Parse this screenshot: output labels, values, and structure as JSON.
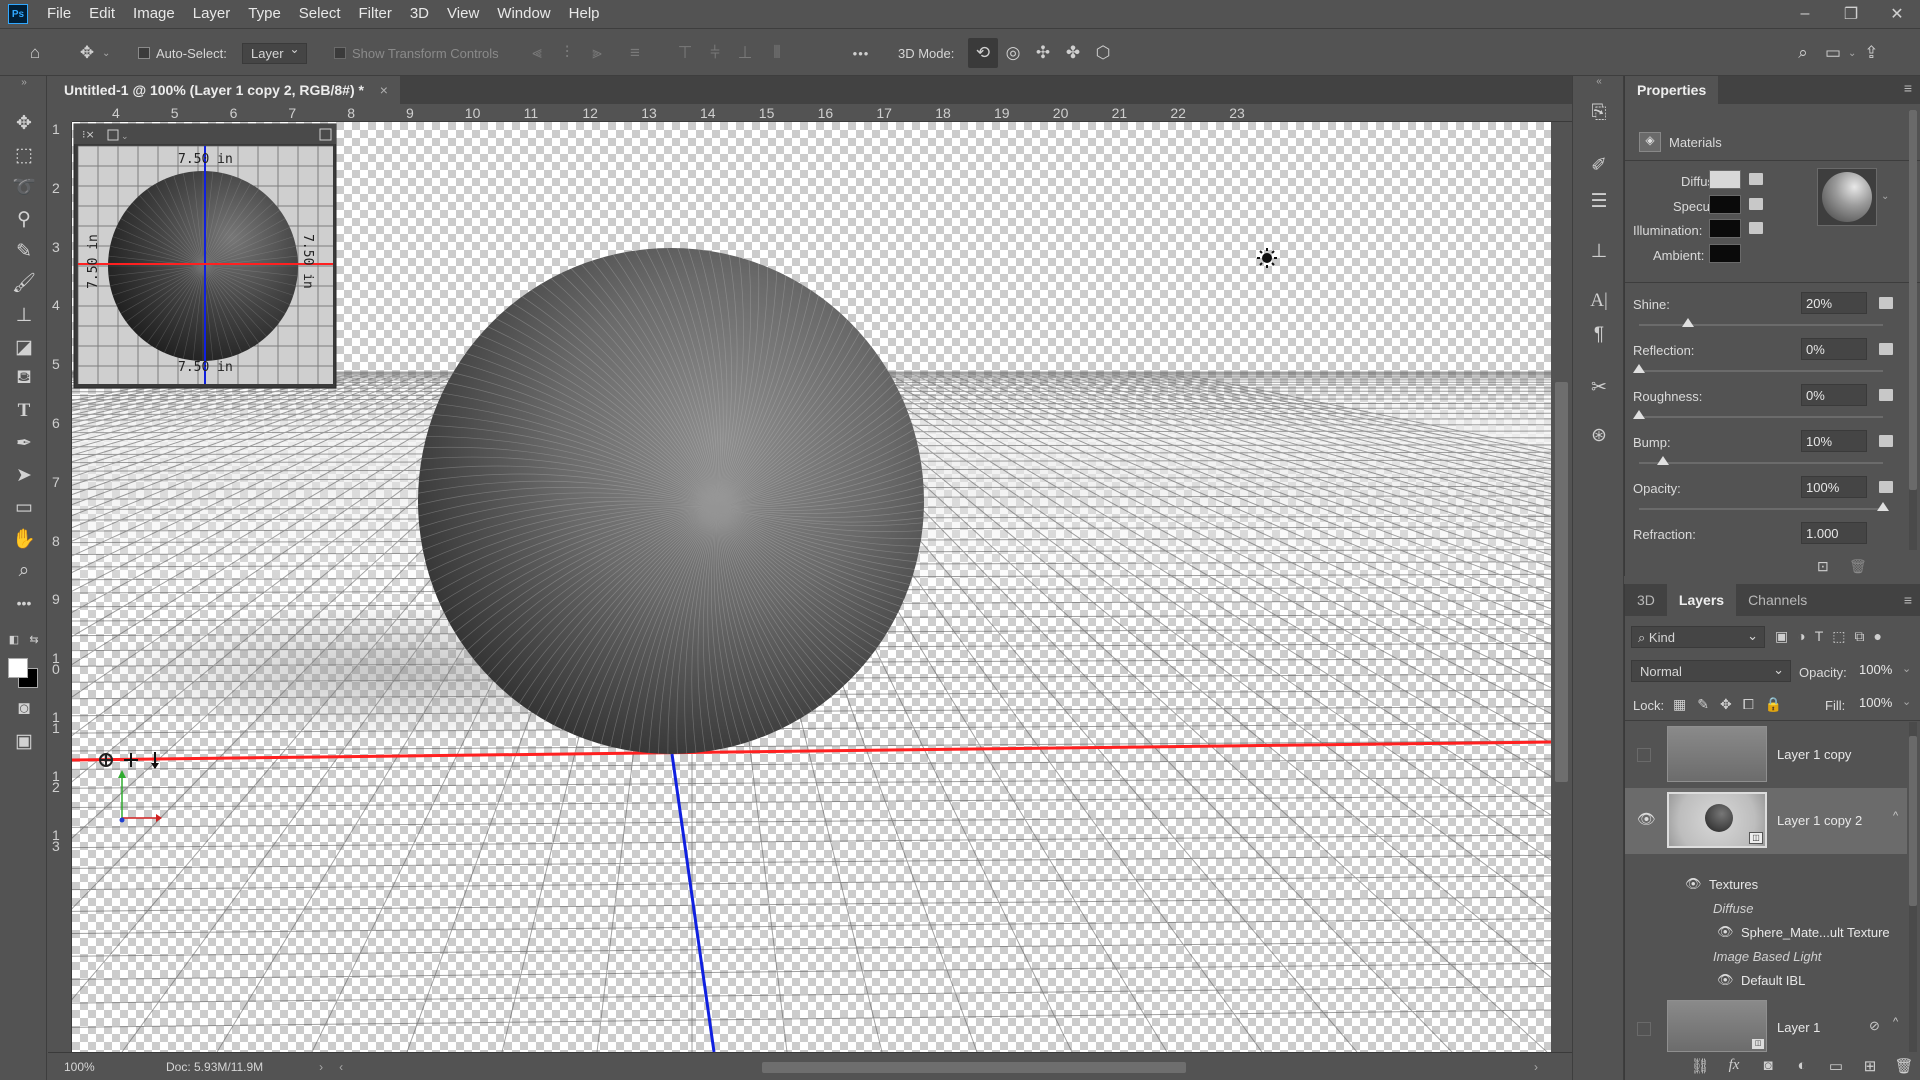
{
  "app": {
    "logo": "Ps"
  },
  "menu": [
    "File",
    "Edit",
    "Image",
    "Layer",
    "Type",
    "Select",
    "Filter",
    "3D",
    "View",
    "Window",
    "Help"
  ],
  "window_controls": {
    "minimize": "–",
    "restore": "❐",
    "close": "✕"
  },
  "options_bar": {
    "auto_select_label": "Auto-Select:",
    "auto_select_value": "Layer",
    "show_transform_label": "Show Transform Controls",
    "more_label": "•••",
    "mode_3d_label": "3D Mode:"
  },
  "document": {
    "tab_title": "Untitled-1 @ 100% (Layer 1 copy 2, RGB/8#) *",
    "tab_close": "×",
    "zoom": "100%",
    "doc_info": "Doc: 5.93M/11.9M",
    "ruler_top": [
      "4",
      "5",
      "6",
      "7",
      "8",
      "9",
      "10",
      "11",
      "12",
      "13",
      "14",
      "15",
      "16",
      "17",
      "18",
      "19",
      "20",
      "21",
      "22",
      "23"
    ],
    "ruler_left": [
      "1",
      "2",
      "3",
      "4",
      "5",
      "6",
      "7",
      "8",
      "9",
      "1\n0",
      "1\n1",
      "1\n2",
      "1\n3"
    ]
  },
  "secondary_view": {
    "label_top": "7.50 in",
    "label_bottom": "7.50 in",
    "label_left": "7.50 in",
    "label_right": "7.50 in"
  },
  "properties": {
    "tab": "Properties",
    "section": "Materials",
    "diffuse_label": "Diffuse:",
    "specular_label": "Specular:",
    "illumination_label": "Illumination:",
    "ambient_label": "Ambient:",
    "shine_label": "Shine:",
    "shine_value": "20%",
    "reflection_label": "Reflection:",
    "reflection_value": "0%",
    "roughness_label": "Roughness:",
    "roughness_value": "0%",
    "bump_label": "Bump:",
    "bump_value": "10%",
    "opacity_label": "Opacity:",
    "opacity_value": "100%",
    "refraction_label": "Refraction:",
    "refraction_value": "1.000",
    "colors": {
      "diffuse": "#d8d8d8",
      "specular": "#0a0a0a",
      "illumination": "#0a0a0a",
      "ambient": "#0a0a0a"
    }
  },
  "layers_panel": {
    "tabs": [
      "3D",
      "Layers",
      "Channels"
    ],
    "kind_label": "Kind",
    "blend_mode": "Normal",
    "opacity_label": "Opacity:",
    "opacity_value": "100%",
    "lock_label": "Lock:",
    "fill_label": "Fill:",
    "fill_value": "100%",
    "layers": [
      {
        "name": "Layer 1 copy"
      },
      {
        "name": "Layer 1 copy 2"
      },
      {
        "name": "Layer 1"
      }
    ],
    "sublist": {
      "textures": "Textures",
      "diffuse": "Diffuse",
      "texture_name": "Sphere_Mate...ult Texture",
      "ibl": "Image Based Light",
      "ibl_name": "Default IBL"
    },
    "bottom_icons": [
      "link-icon",
      "fx-icon",
      "mask-icon",
      "adjustment-icon",
      "folder-icon",
      "new-layer-icon",
      "trash-icon"
    ]
  }
}
